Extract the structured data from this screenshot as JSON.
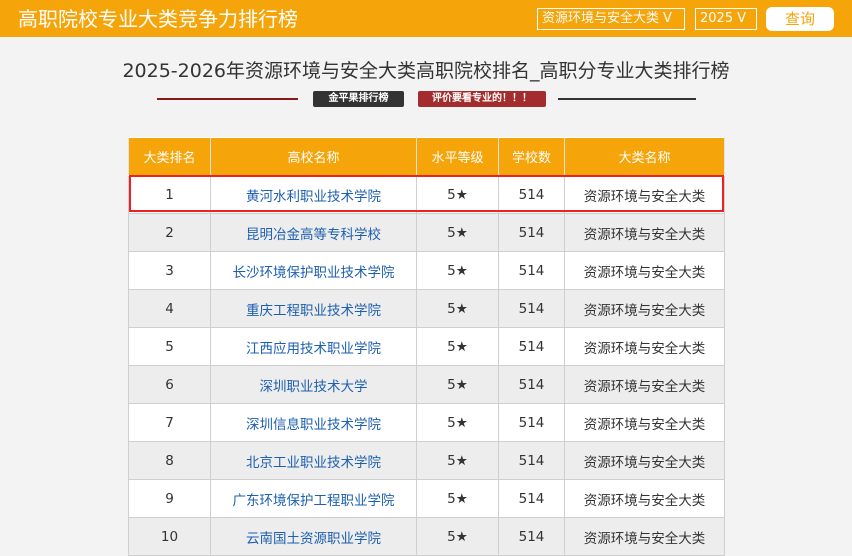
{
  "header": {
    "title": "高职院校专业大类竞争力排行榜",
    "major_select": "资源环境与安全大类",
    "year_select": "2025",
    "chevron": "V",
    "query_button": "查询"
  },
  "heading": "2025-2026年资源环境与安全大类高职院校排名_高职分专业大类排行榜",
  "tags": {
    "source": "金平果排行榜",
    "note": "评价要看专业的！！！"
  },
  "table": {
    "columns": [
      "大类排名",
      "高校名称",
      "水平等级",
      "学校数",
      "大类名称"
    ],
    "rows": [
      {
        "rank": "1",
        "name": "黄河水利职业技术学院",
        "level": "5★",
        "count": "514",
        "category": "资源环境与安全大类"
      },
      {
        "rank": "2",
        "name": "昆明冶金高等专科学校",
        "level": "5★",
        "count": "514",
        "category": "资源环境与安全大类"
      },
      {
        "rank": "3",
        "name": "长沙环境保护职业技术学院",
        "level": "5★",
        "count": "514",
        "category": "资源环境与安全大类"
      },
      {
        "rank": "4",
        "name": "重庆工程职业技术学院",
        "level": "5★",
        "count": "514",
        "category": "资源环境与安全大类"
      },
      {
        "rank": "5",
        "name": "江西应用技术职业学院",
        "level": "5★",
        "count": "514",
        "category": "资源环境与安全大类"
      },
      {
        "rank": "6",
        "name": "深圳职业技术大学",
        "level": "5★",
        "count": "514",
        "category": "资源环境与安全大类"
      },
      {
        "rank": "7",
        "name": "深圳信息职业技术学院",
        "level": "5★",
        "count": "514",
        "category": "资源环境与安全大类"
      },
      {
        "rank": "8",
        "name": "北京工业职业技术学院",
        "level": "5★",
        "count": "514",
        "category": "资源环境与安全大类"
      },
      {
        "rank": "9",
        "name": "广东环境保护工程职业学院",
        "level": "5★",
        "count": "514",
        "category": "资源环境与安全大类"
      },
      {
        "rank": "10",
        "name": "云南国土资源职业学院",
        "level": "5★",
        "count": "514",
        "category": "资源环境与安全大类"
      }
    ]
  },
  "colors": {
    "accent": "#f5a409",
    "highlight_border": "#ee2222",
    "link": "#1d5fb0"
  }
}
